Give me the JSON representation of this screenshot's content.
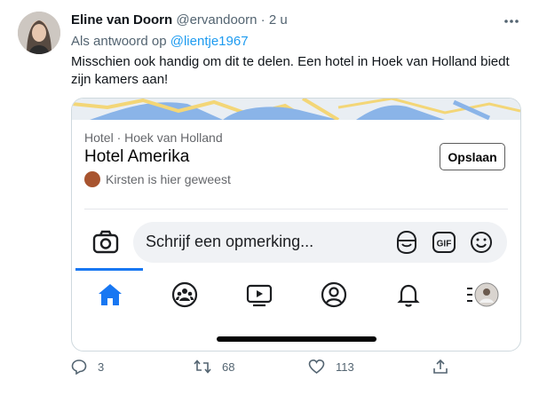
{
  "tweet": {
    "author_name": "Eline van Doorn",
    "handle": "@ervandoorn",
    "separator": "·",
    "time": "2 u",
    "reply_prefix": "Als antwoord op",
    "reply_handle": "@lientje1967",
    "text": "Misschien ook handig om dit te delen. Een hotel in Hoek van Holland biedt zijn kamers aan!"
  },
  "card": {
    "category": "Hotel · Hoek van Holland",
    "title": "Hotel Amerika",
    "visited": "Kirsten is hier geweest",
    "save_label": "Opslaan"
  },
  "comment": {
    "placeholder": "Schrijf een opmerking..."
  },
  "nav": {
    "icons": [
      "home-icon",
      "groups-icon",
      "watch-icon",
      "profile-icon",
      "notifications-icon",
      "menu-icon"
    ]
  },
  "actions": {
    "replies": "3",
    "retweets": "68",
    "likes": "113"
  },
  "colors": {
    "accent": "#1d9bf0",
    "facebook_blue": "#1877f2"
  }
}
